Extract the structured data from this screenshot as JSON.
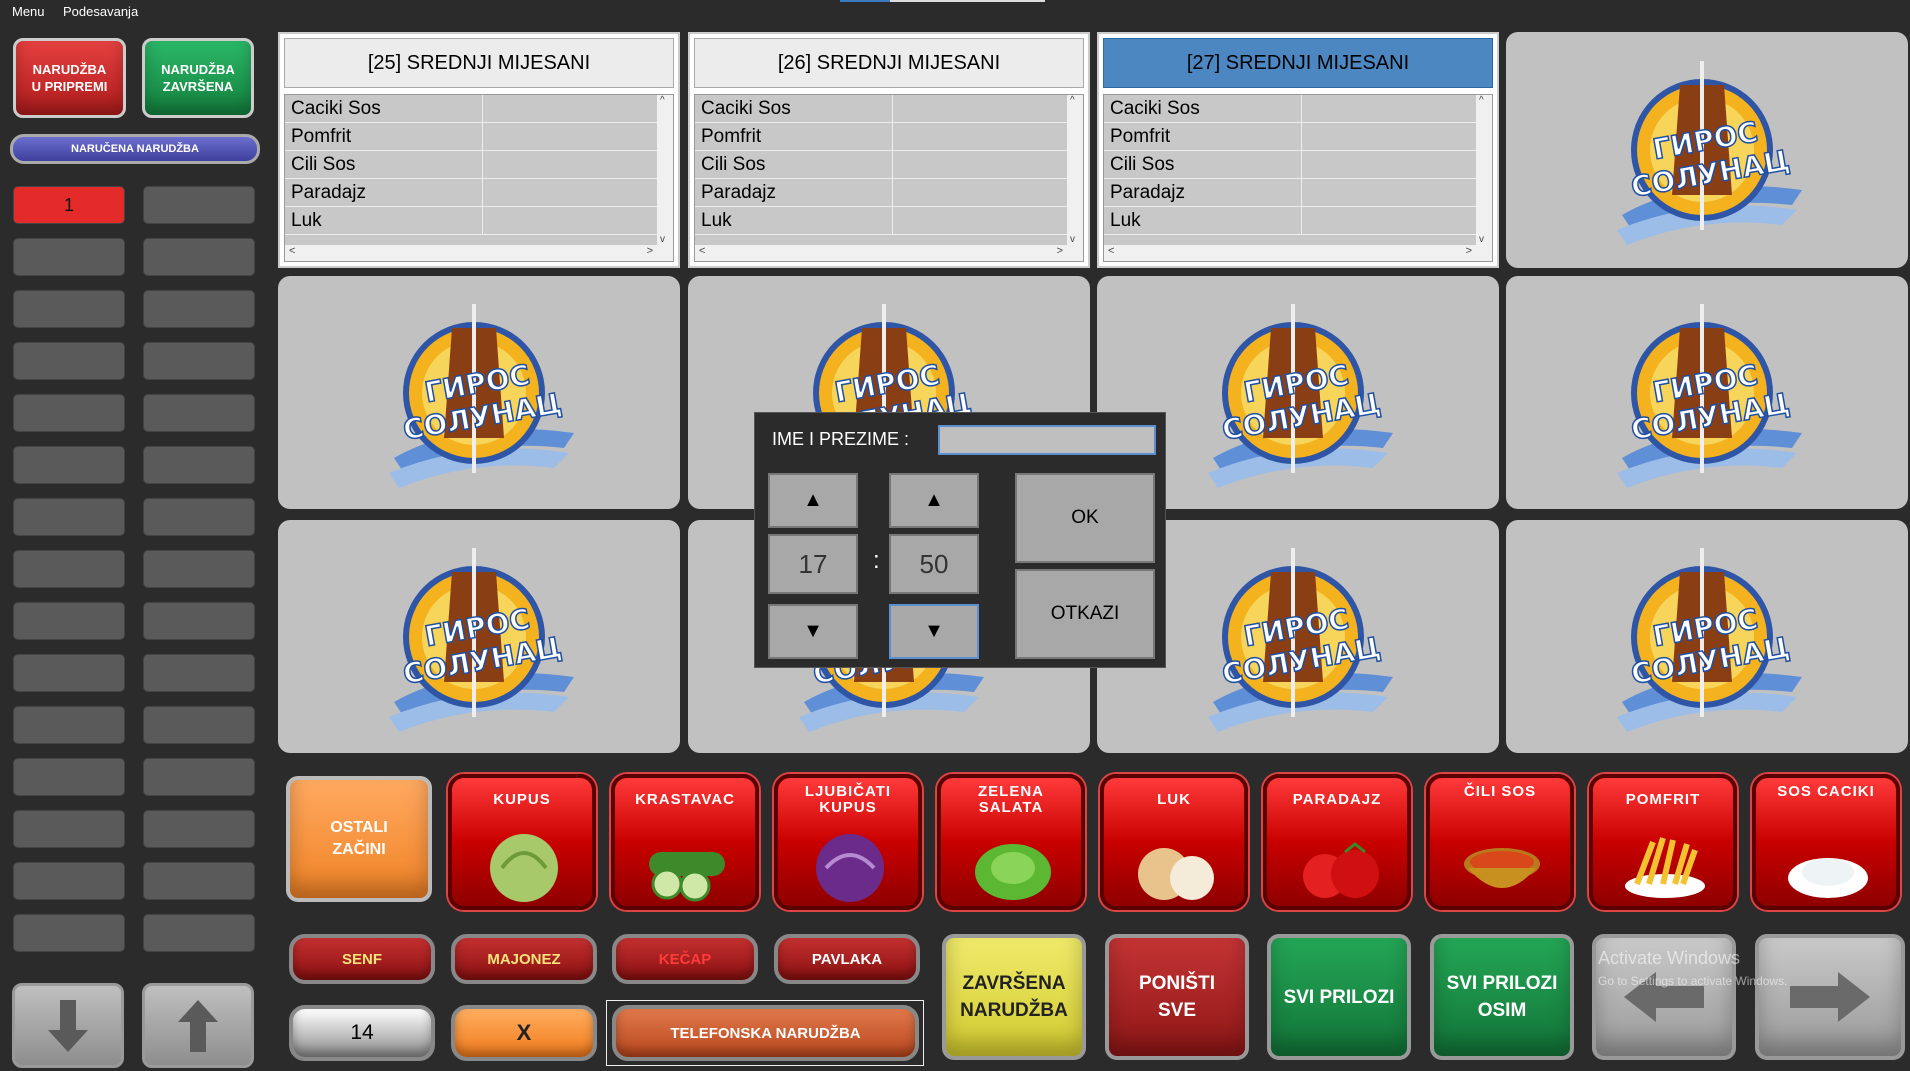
{
  "menubar": {
    "menu": "Menu",
    "settings": "Podesavanja"
  },
  "left_panel": {
    "btn_in_prep": "NARUDŽBA U PRIPREMI",
    "btn_done": "NARUDŽBA ZAVRŠENA",
    "btn_ordered": "NARUČENA NARUDŽBA",
    "active_slot": "1"
  },
  "orders": [
    {
      "title": "[25] SREDNJI MIJESANI",
      "items": [
        "Caciki Sos",
        "Pomfrit",
        "Cili Sos",
        "Paradajz",
        "Luk"
      ],
      "selected": false
    },
    {
      "title": "[26] SREDNJI MIJESANI",
      "items": [
        "Caciki Sos",
        "Pomfrit",
        "Cili Sos",
        "Paradajz",
        "Luk"
      ],
      "selected": false
    },
    {
      "title": "[27] SREDNJI MIJESANI",
      "items": [
        "Caciki Sos",
        "Pomfrit",
        "Cili Sos",
        "Paradajz",
        "Luk"
      ],
      "selected": true
    }
  ],
  "logo": {
    "line1": "ГИРОС",
    "line2": "СОЛУНАЦ"
  },
  "dialog": {
    "name_label": "IME I PREZIME :",
    "name_value": "",
    "hour": "17",
    "sep": ":",
    "minute": "50",
    "up": "▲",
    "down": "▼",
    "ok": "OK",
    "cancel": "OTKAZI"
  },
  "ingredients": [
    "KUPUS",
    "KRASTAVAC",
    "LJUBIČATI KUPUS",
    "ZELENA SALATA",
    "LUK",
    "PARADAJZ",
    "ČILI SOS",
    "POMFRIT",
    "SOS CACIKI"
  ],
  "other_spices": "OSTALI ZAČINI",
  "condiments": {
    "senf": "SENF",
    "majonez": "MAJONEZ",
    "kecap": "KEČAP",
    "pavlaka": "PAVLAKA"
  },
  "quantity": "14",
  "clear": "X",
  "phone_order": "TELEFONSKA NARUDŽBA",
  "actions": {
    "done": "ZAVRŠENA NARUDŽBA",
    "reset": "PONIŠTI SVE",
    "all_sides": "SVI PRILOZI",
    "all_sides_except": "SVI PRILOZI OSIM"
  },
  "watermark": {
    "line1": "Activate Windows",
    "line2": "Go to Settings to activate Windows."
  },
  "colors": {
    "red": "#d01818",
    "green": "#14a04a",
    "blue_sel": "#4c87c2",
    "orange": "#f79a3c",
    "yellow": "#e8e04a"
  }
}
